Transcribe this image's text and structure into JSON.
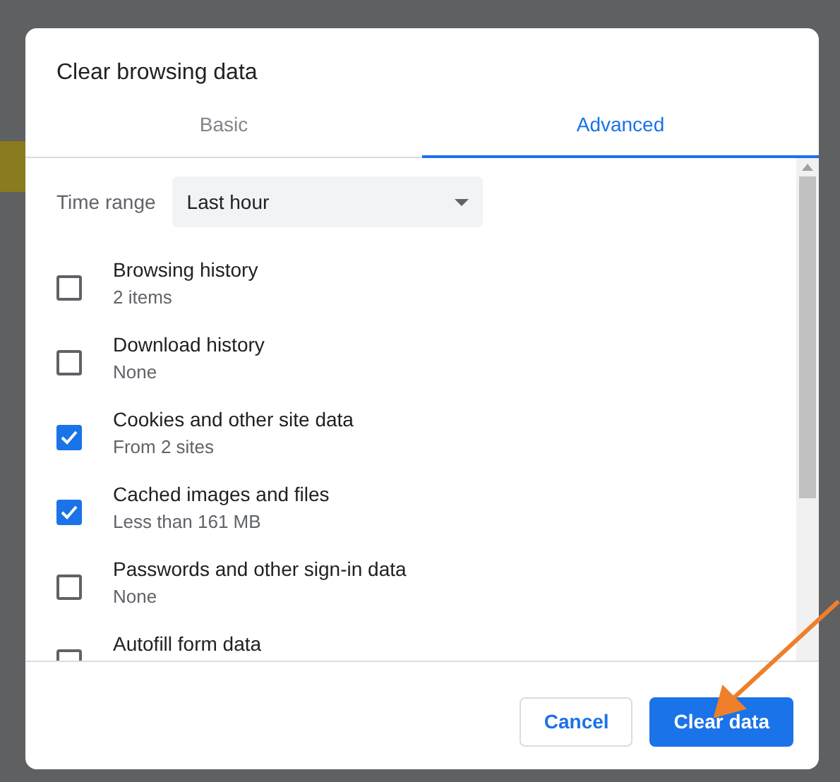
{
  "dialog": {
    "title": "Clear browsing data"
  },
  "tabs": [
    {
      "label": "Basic",
      "selected": false
    },
    {
      "label": "Advanced",
      "selected": true
    }
  ],
  "time_range": {
    "label": "Time range",
    "value": "Last hour"
  },
  "items": [
    {
      "label": "Browsing history",
      "detail": "2 items",
      "checked": false
    },
    {
      "label": "Download history",
      "detail": "None",
      "checked": false
    },
    {
      "label": "Cookies and other site data",
      "detail": "From 2 sites",
      "checked": true
    },
    {
      "label": "Cached images and files",
      "detail": "Less than 161 MB",
      "checked": true
    },
    {
      "label": "Passwords and other sign-in data",
      "detail": "None",
      "checked": false
    },
    {
      "label": "Autofill form data",
      "checked": false
    }
  ],
  "buttons": [
    {
      "label": "Cancel",
      "kind": "secondary"
    },
    {
      "label": "Clear data",
      "kind": "primary"
    }
  ]
}
